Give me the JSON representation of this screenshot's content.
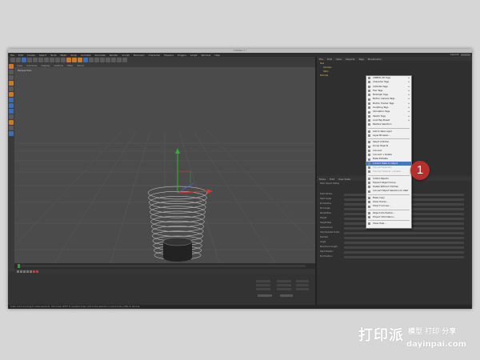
{
  "app": {
    "title": "Untitled 1 *",
    "menu": [
      "File",
      "Edit",
      "Create",
      "Select",
      "Tools",
      "Mesh",
      "Snap",
      "Animate",
      "Simulate",
      "Render",
      "Sculpt",
      "MoGraph",
      "Character",
      "Pipeline",
      "Plugins",
      "Script",
      "Window",
      "Help"
    ],
    "layout_label": "Layout:"
  },
  "viewport": {
    "menu": [
      "View",
      "Cameras",
      "Display",
      "Options",
      "Filter",
      "Panel"
    ],
    "label": "Perspective"
  },
  "object_manager": {
    "menu": [
      "File",
      "Edit",
      "View",
      "Objects",
      "Tags",
      "Bookmarks"
    ],
    "objects": [
      "Null",
      "Cylinder",
      "Helix",
      "Extrude"
    ]
  },
  "context_menu": {
    "items": [
      {
        "label": "CINEMA 4D Tags",
        "arrow": true,
        "state": "normal"
      },
      {
        "label": "Character Tags",
        "arrow": true,
        "state": "normal"
      },
      {
        "label": "Clothilde Tags",
        "arrow": true,
        "state": "normal"
      },
      {
        "label": "Hair Tags",
        "arrow": true,
        "state": "normal"
      },
      {
        "label": "MoGraph Tags",
        "arrow": true,
        "state": "normal"
      },
      {
        "label": "Motion Camera Tags",
        "arrow": true,
        "state": "normal"
      },
      {
        "label": "Motion Tracker Tags",
        "arrow": true,
        "state": "normal"
      },
      {
        "label": "Sculpting Tags",
        "arrow": true,
        "state": "normal"
      },
      {
        "label": "Simulation Tags",
        "arrow": true,
        "state": "normal"
      },
      {
        "label": "Sketch Tags",
        "arrow": true,
        "state": "normal"
      },
      {
        "label": "Load Tag Preset",
        "arrow": true,
        "state": "normal"
      },
      {
        "label": "Restore Selection",
        "arrow": false,
        "state": "normal"
      },
      {
        "label": "Add to New Layer",
        "arrow": false,
        "state": "normal"
      },
      {
        "label": "Layer Browser...",
        "arrow": false,
        "state": "normal"
      },
      {
        "label": "Select Children",
        "arrow": false,
        "state": "normal"
      },
      {
        "label": "Group Objects",
        "arrow": false,
        "state": "normal"
      },
      {
        "label": "Connect",
        "arrow": false,
        "state": "normal"
      },
      {
        "label": "Connect + Delete",
        "arrow": false,
        "state": "normal"
      },
      {
        "label": "Make Editable",
        "arrow": false,
        "state": "normal"
      },
      {
        "label": "Current State to Object",
        "arrow": false,
        "state": "highlighted"
      },
      {
        "label": "Convert Selection",
        "arrow": false,
        "state": "dim"
      },
      {
        "label": "Connect Objects + Delete",
        "arrow": false,
        "state": "dim"
      },
      {
        "label": "Unfold Objects",
        "arrow": false,
        "state": "normal"
      },
      {
        "label": "Expand Object Group",
        "arrow": false,
        "state": "normal"
      },
      {
        "label": "Delete Without Children",
        "arrow": false,
        "state": "normal"
      },
      {
        "label": "Convert Object Selection to XRef",
        "arrow": false,
        "state": "normal"
      },
      {
        "label": "Make Copy",
        "arrow": false,
        "state": "normal"
      },
      {
        "label": "Show Tracks...",
        "arrow": false,
        "state": "normal"
      },
      {
        "label": "Show F-Curves...",
        "arrow": false,
        "state": "normal"
      },
      {
        "label": "Object Information...",
        "arrow": false,
        "state": "normal"
      },
      {
        "label": "Project Information...",
        "arrow": false,
        "state": "normal"
      },
      {
        "label": "Show Help...",
        "arrow": false,
        "state": "normal"
      }
    ]
  },
  "attributes": {
    "menu": [
      "Mode",
      "Edit",
      "User Data"
    ],
    "title": "Helix Object [Helix]",
    "rows": [
      "Start Radius",
      "Start Angle",
      "End Radius",
      "End Angle",
      "Radial Bias",
      "Height",
      "Height Bias",
      "Subdivisions",
      "Intermediate Points",
      "Number",
      "Angle",
      "Maximum Length",
      "Start Position",
      "End Position"
    ]
  },
  "badge": {
    "label": "1",
    "color": "#b5302a"
  },
  "status": {
    "text": "Scale: Click and drag to scale elements. Hold down SHIFT to quantize scale / add to the selection in point mode, CTRL to remove."
  },
  "watermark": {
    "line1": "打印派",
    "line2": "模型 打印 分享",
    "line3": "dayinpai.com"
  }
}
